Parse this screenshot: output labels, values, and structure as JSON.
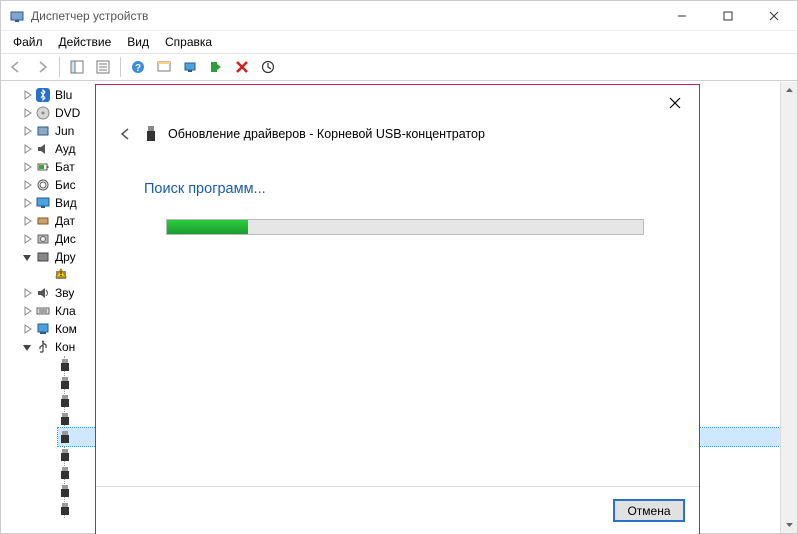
{
  "window": {
    "title": "Диспетчер устройств"
  },
  "menu": {
    "file": "Файл",
    "action": "Действие",
    "view": "Вид",
    "help": "Справка"
  },
  "tree": {
    "items": [
      {
        "label": "Blu",
        "icon": "bluetooth",
        "expandable": true
      },
      {
        "label": "DVD",
        "icon": "dvd",
        "expandable": true
      },
      {
        "label": "Jun",
        "icon": "device",
        "expandable": true
      },
      {
        "label": "Ауд",
        "icon": "audio",
        "expandable": true
      },
      {
        "label": "Бат",
        "icon": "battery",
        "expandable": true
      },
      {
        "label": "Бис",
        "icon": "fingerprint",
        "expandable": true
      },
      {
        "label": "Вид",
        "icon": "display",
        "expandable": true
      },
      {
        "label": "Дат",
        "icon": "sensor",
        "expandable": true
      },
      {
        "label": "Дис",
        "icon": "disk",
        "expandable": true
      },
      {
        "label": "Дру",
        "icon": "other",
        "expandable": true,
        "expanded": true,
        "children": [
          {
            "label": "",
            "icon": "warn"
          }
        ]
      },
      {
        "label": "Зву",
        "icon": "sound",
        "expandable": true
      },
      {
        "label": "Кла",
        "icon": "keyboard",
        "expandable": true
      },
      {
        "label": "Ком",
        "icon": "computer",
        "expandable": true
      },
      {
        "label": "Кон",
        "icon": "usb",
        "expandable": true,
        "expanded": true,
        "children": [
          {
            "icon": "usb-port"
          },
          {
            "icon": "usb-port"
          },
          {
            "icon": "usb-port"
          },
          {
            "icon": "usb-port"
          },
          {
            "icon": "usb-port",
            "selected": true
          },
          {
            "icon": "usb-port"
          },
          {
            "icon": "usb-port"
          },
          {
            "icon": "usb-port"
          },
          {
            "icon": "usb-port"
          }
        ]
      }
    ]
  },
  "modal": {
    "title": "Обновление драйверов - Корневой USB-концентратор",
    "status": "Поиск программ...",
    "progress_percent": 17,
    "cancel": "Отмена"
  }
}
